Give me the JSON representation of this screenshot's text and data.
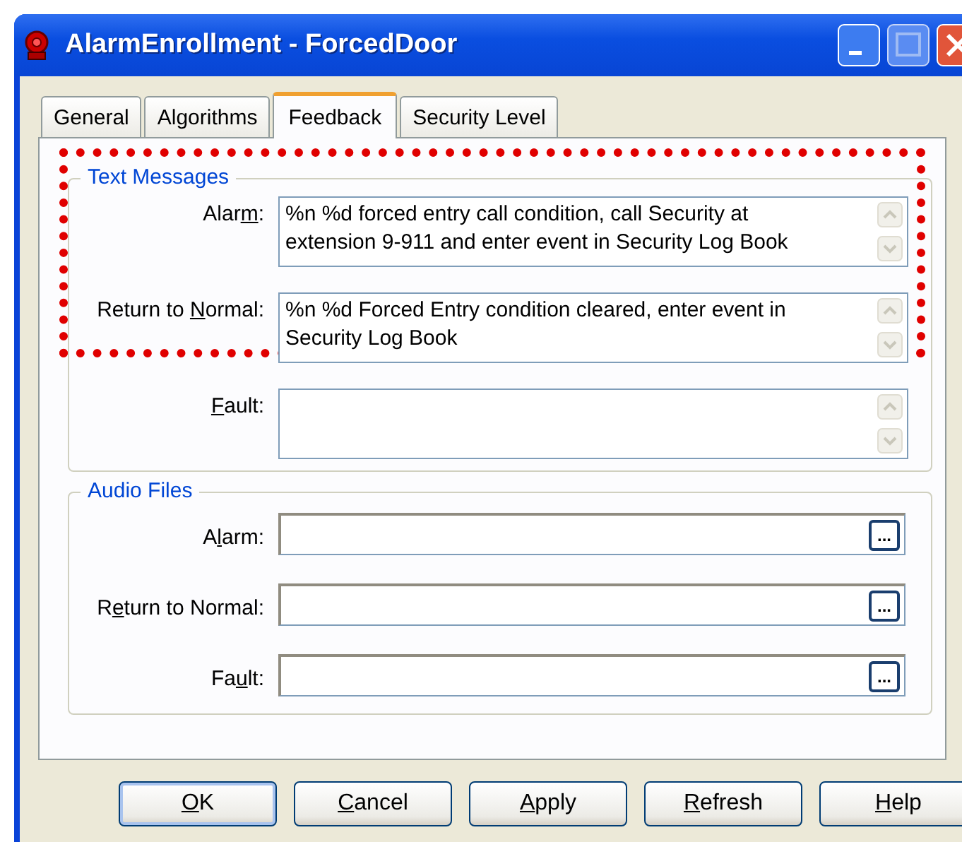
{
  "window": {
    "title": "AlarmEnrollment - ForcedDoor"
  },
  "tabs": [
    {
      "label": "General",
      "selected": false
    },
    {
      "label": "Algorithms",
      "selected": false
    },
    {
      "label": "Feedback",
      "selected": true
    },
    {
      "label": "Security Level",
      "selected": false
    }
  ],
  "text_messages": {
    "title": "Text Messages",
    "fields": [
      {
        "label": {
          "before": "Alar",
          "key": "m",
          "after": ":"
        },
        "value": "%n %d forced entry call condition, call Security at extension 9-911 and enter event in Security Log Book",
        "highlighted": true
      },
      {
        "label": {
          "before": "Return to ",
          "key": "N",
          "after": "ormal:"
        },
        "value": "%n %d Forced Entry condition cleared, enter event in Security Log Book",
        "highlighted": true
      },
      {
        "label": {
          "key": "F",
          "after": "ault:"
        },
        "highlighted": false
      }
    ]
  },
  "audio_files": {
    "title": "Audio Files",
    "fields": [
      {
        "label": {
          "before": "A",
          "key": "l",
          "after": "arm:"
        },
        "browse": "..."
      },
      {
        "label": {
          "before": "R",
          "key": "e",
          "after": "turn to Normal:"
        },
        "browse": "..."
      },
      {
        "label": {
          "before": "Fa",
          "key": "u",
          "after": "lt:"
        },
        "browse": "..."
      }
    ]
  },
  "buttons": [
    {
      "label": {
        "key": "O",
        "after": "K"
      },
      "default": true
    },
    {
      "label": {
        "key": "C",
        "after": "ancel"
      },
      "default": false
    },
    {
      "label": {
        "key": "A",
        "after": "pply"
      },
      "default": false
    },
    {
      "label": {
        "key": "R",
        "after": "efresh"
      },
      "default": false
    },
    {
      "label": {
        "key": "H",
        "after": "elp"
      },
      "default": false
    }
  ]
}
